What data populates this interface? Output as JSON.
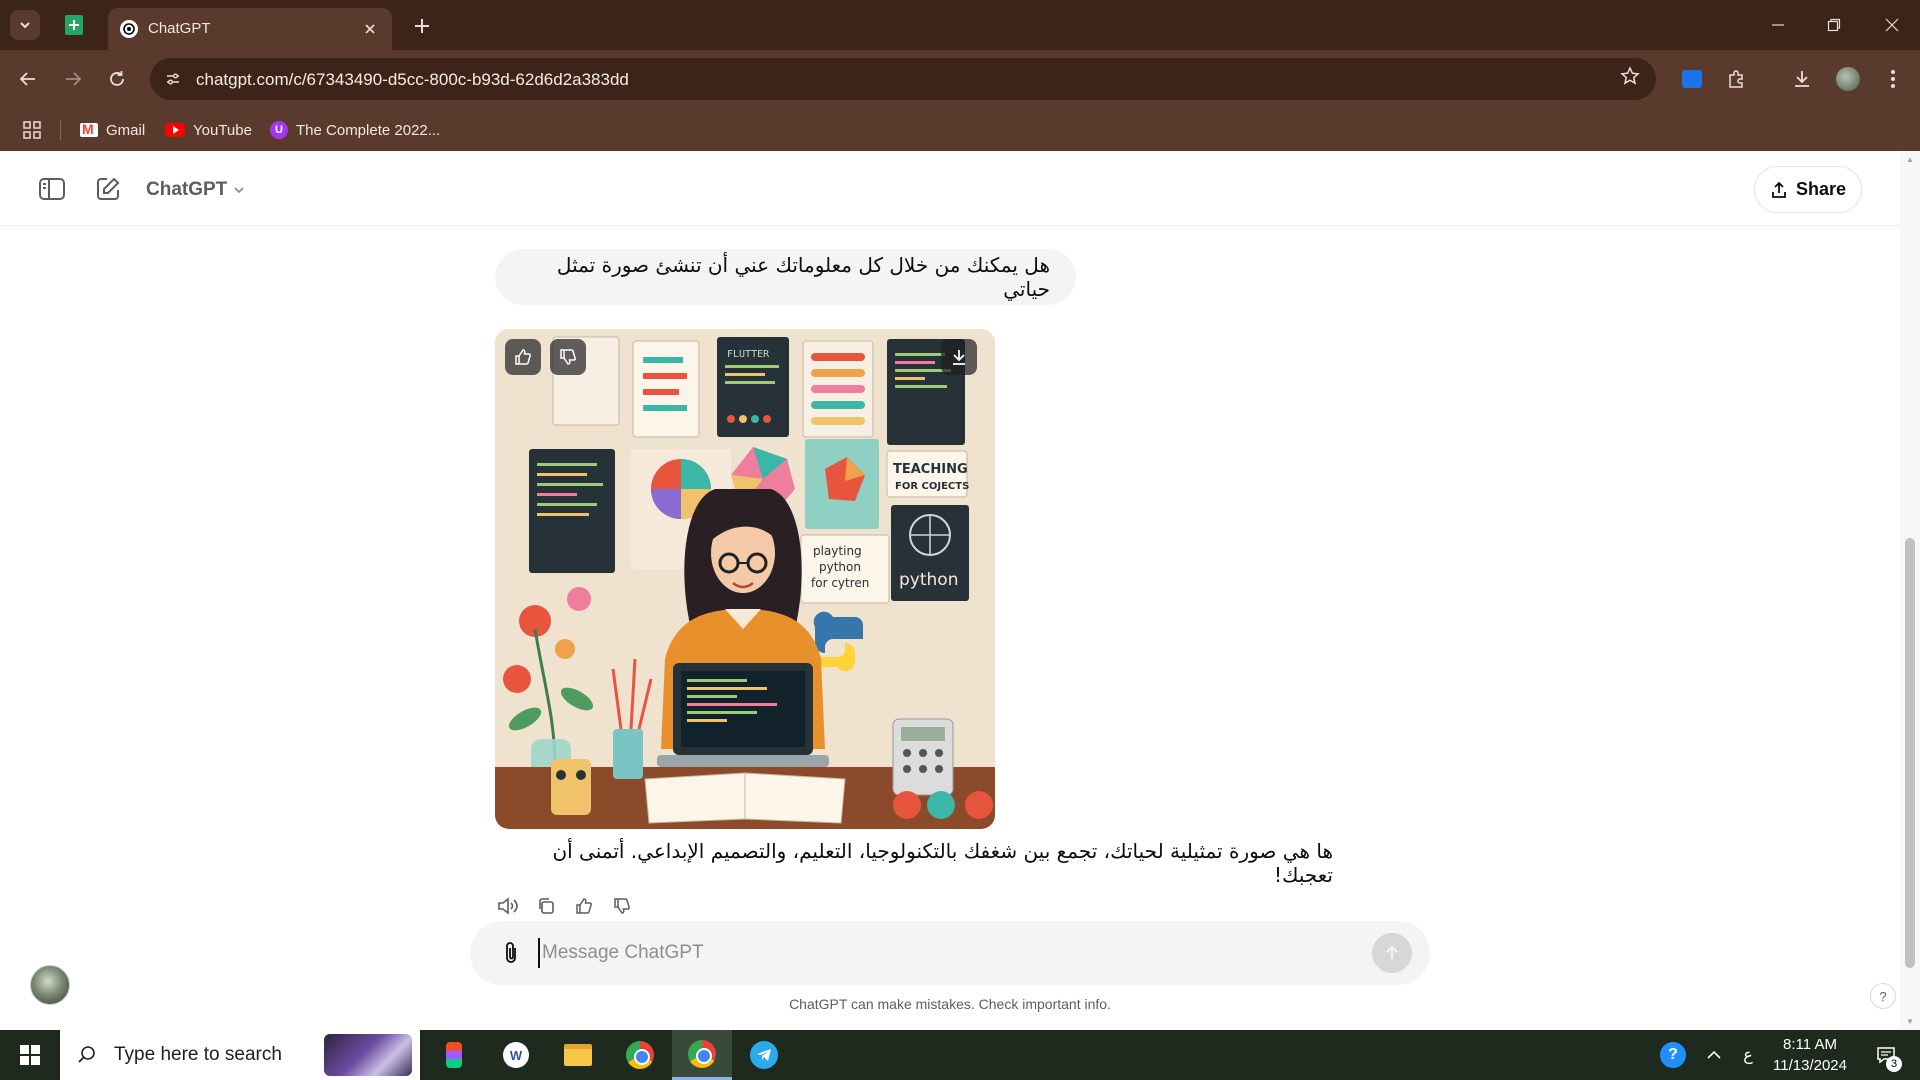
{
  "browser": {
    "tab_title": "ChatGPT",
    "url": "chatgpt.com/c/67343490-d5cc-800c-b93d-62d6d2a383dd",
    "bookmarks": [
      {
        "label": "Gmail"
      },
      {
        "label": "YouTube"
      },
      {
        "label": "The Complete 2022..."
      }
    ]
  },
  "header": {
    "model_name": "ChatGPT",
    "share_label": "Share"
  },
  "conversation": {
    "user_message": "هل يمكنك من خلال كل معلوماتك عني أن تنشئ صورة تمثل حياتي",
    "image_texts": {
      "flutter": "FLUTTER",
      "teaching": "TEACHING",
      "teaching_sub": "FOR COJECTS",
      "playing_1": "playting",
      "playing_2": "python",
      "playing_3": "for cytren",
      "python": "python"
    },
    "assistant_message": "ها هي صورة تمثيلية لحياتك، تجمع بين شغفك بالتكنولوجيا، التعليم، والتصميم الإبداعي. أتمنى أن تعجبك!"
  },
  "composer": {
    "placeholder": "Message ChatGPT"
  },
  "footer": {
    "disclaimer": "ChatGPT can make mistakes. Check important info.",
    "help": "?"
  },
  "taskbar": {
    "search_placeholder": "Type here to search",
    "language": "ع",
    "time": "8:11 AM",
    "date": "11/13/2024",
    "notification_count": "3"
  },
  "colors": {
    "chrome_frame": "#3d2418",
    "chrome_toolbar": "#5a3a2c",
    "bubble_bg": "#f4f4f4",
    "taskbar_bg": "#1f2a1e"
  }
}
